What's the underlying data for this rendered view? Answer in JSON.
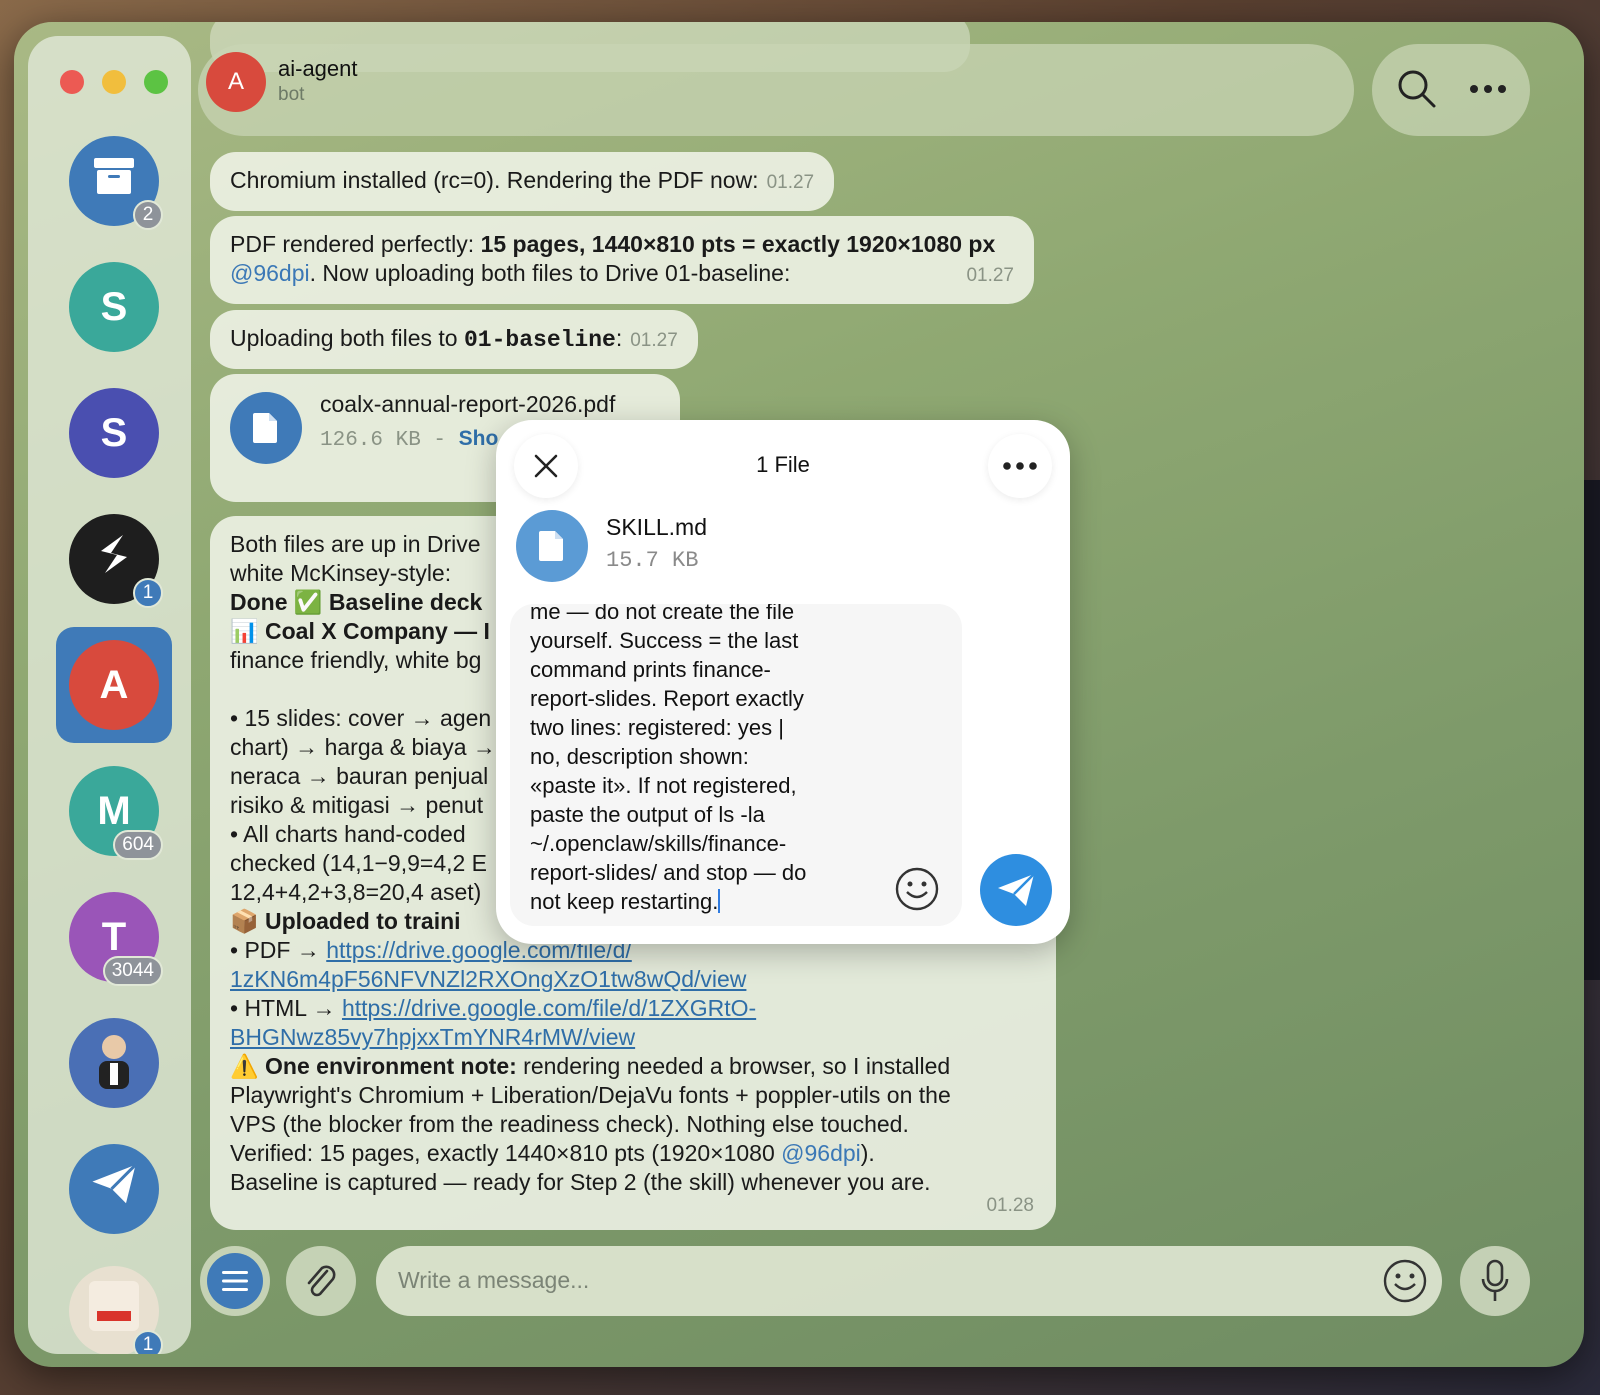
{
  "window": {
    "title": "ai-agent"
  },
  "sidebar": {
    "items": [
      {
        "name": "archive",
        "letter": "",
        "badge": "2",
        "color": "#3f7ab8"
      },
      {
        "name": "chat-s-teal",
        "letter": "S",
        "badge": "",
        "color": "#3aa89a"
      },
      {
        "name": "chat-s-purple",
        "letter": "S",
        "badge": "",
        "color": "#4a4fb0"
      },
      {
        "name": "chat-s-black",
        "letter": "",
        "badge": "1",
        "color": "#1e1e1e"
      },
      {
        "name": "chat-ai-agent",
        "letter": "A",
        "badge": "",
        "color": "#d84a3d"
      },
      {
        "name": "chat-m",
        "letter": "M",
        "badge": "604",
        "color": "#3aa89a"
      },
      {
        "name": "chat-t",
        "letter": "T",
        "badge": "3044",
        "color": "#9a55b8"
      },
      {
        "name": "chat-photo",
        "letter": "",
        "badge": "",
        "color": "#4a6fb5"
      },
      {
        "name": "chat-telegram",
        "letter": "",
        "badge": "",
        "color": "#3f7ab8"
      },
      {
        "name": "chat-ditsel",
        "letter": "",
        "badge": "1",
        "color": "#e8e0d0"
      }
    ]
  },
  "header": {
    "avatar_letter": "A",
    "title": "ai-agent",
    "subtitle": "bot"
  },
  "messages": {
    "m1": {
      "text": "Chromium installed (rc=0). Rendering the PDF now:",
      "time": "01.27"
    },
    "m2": {
      "prefix": "PDF rendered perfectly: ",
      "bold": "15 pages, 1440×810 pts = exactly 1920×1080 px",
      "mention": "@96dpi",
      "suffix": ". Now uploading both files to Drive 01-baseline:",
      "time": "01.27"
    },
    "m3": {
      "prefix": "Uploading both files to ",
      "code": "01-baseline",
      "suffix": ":",
      "time": "01.27"
    },
    "m4": {
      "file_name": "coalx-annual-report-2026.pdf",
      "file_size": "126.6 KB - ",
      "file_link": "Sho"
    },
    "m5": {
      "l1": "Both files are up in Drive",
      "l2": "white McKinsey-style:",
      "l3a": "Done ✅ Baseline deck",
      "l4": "📊 Coal X Company — I",
      "l5": "finance friendly, white bg",
      "l6": "• 15 slides: cover → agen",
      "l7": "chart) → harga & biaya →",
      "l8": "neraca → bauran penjual",
      "l9": "risiko & mitigasi → penut",
      "l10": "• All charts hand-coded",
      "l11": "checked (14,1−9,9=4,2 E",
      "l12": "12,4+4,2+3,8=20,4 aset)",
      "l13": "📦 Uploaded to traini",
      "pdf_label": "• PDF → ",
      "pdf_link_a": "https://drive.google.com/file/d/",
      "pdf_link_b": "1zKN6m4pF56NFVNZl2RXOngXzO1tw8wQd/view",
      "html_label": "• HTML → ",
      "html_link_a": "https://drive.google.com/file/d/1ZXGRtO-",
      "html_link_b": "BHGNwz85vy7hpjxxTmYNR4rMW/view",
      "env_bold": "⚠️ One environment note:",
      "env_rest": " rendering needed a browser, so I installed",
      "env2": "Playwright's Chromium + Liberation/DejaVu fonts + poppler-utils on the",
      "env3": "VPS (the blocker from the readiness check). Nothing else touched.",
      "env4a": "Verified: 15 pages, exactly 1440×810 pts (1920×1080 ",
      "env4mention": "@96dpi",
      "env4b": ").",
      "env5": "Baseline is captured — ready for Step 2 (the skill) whenever you are.",
      "time": "01.28"
    }
  },
  "composer": {
    "placeholder": "Write a message..."
  },
  "modal": {
    "title": "1 File",
    "file_name": "SKILL.md",
    "file_size": "15.7 KB",
    "caption": "me — do not create the file\nyourself. Success = the last\ncommand prints finance-\nreport-slides. Report exactly\ntwo lines: registered: yes |\nno, description shown:\n«paste it». If not registered,\npaste the output of ls -la\n~/.openclaw/skills/finance-\nreport-slides/ and stop — do\nnot keep restarting."
  },
  "colors": {
    "accent": "#2e8ee0",
    "link": "#2f6ea8",
    "bubble": "#f0f4e8"
  }
}
